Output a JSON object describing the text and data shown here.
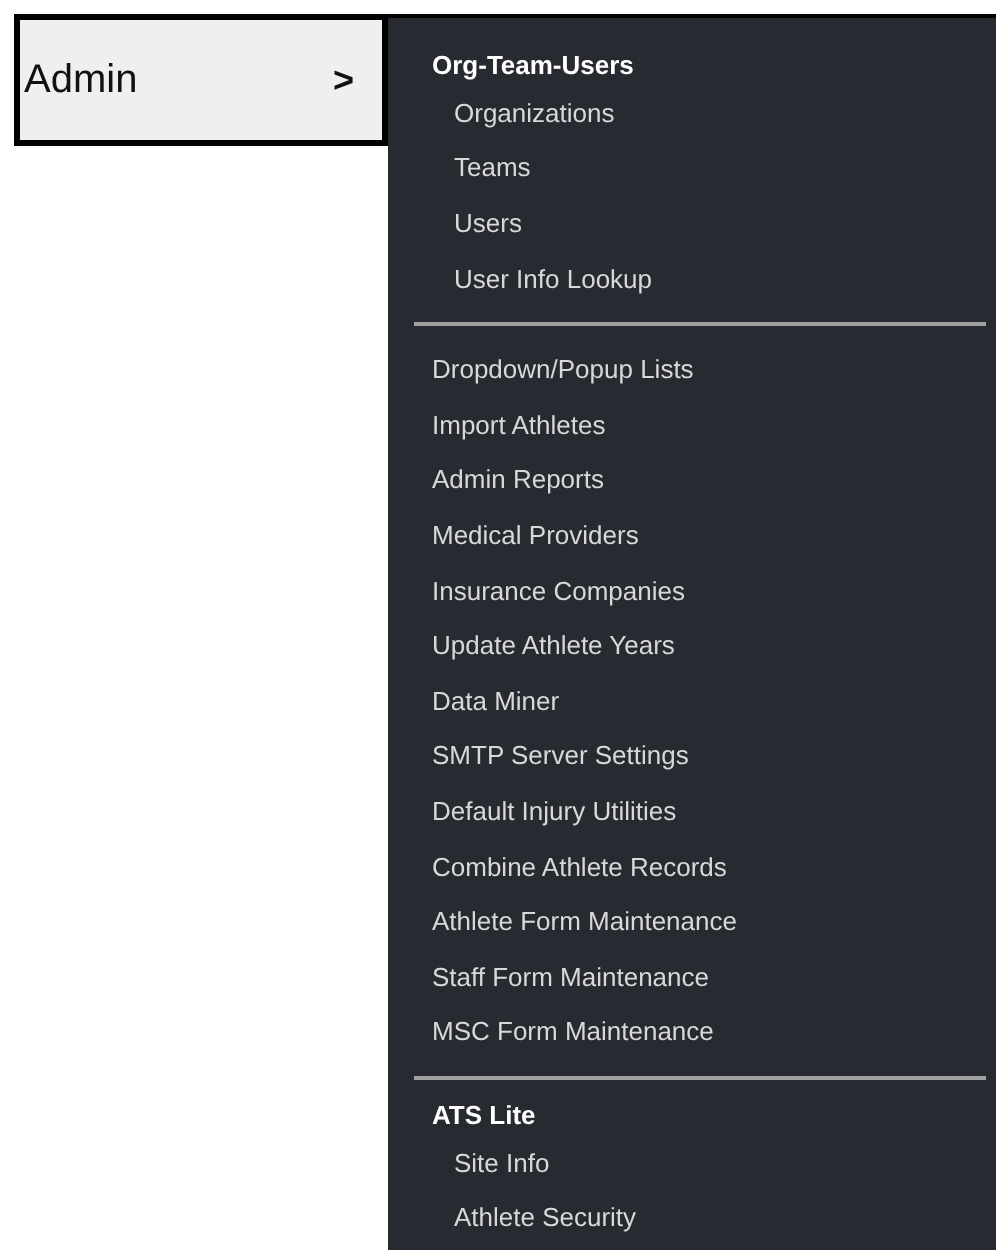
{
  "trigger": {
    "label": "Admin",
    "caret": ">"
  },
  "menu": {
    "sections": [
      {
        "heading": "Org-Team-Users",
        "items": [
          "Organizations",
          "Teams",
          "Users",
          "User Info Lookup"
        ]
      },
      {
        "items": [
          "Dropdown/Popup Lists",
          "Import Athletes",
          "Admin Reports",
          "Medical Providers",
          "Insurance Companies",
          "Update Athlete Years",
          "Data Miner",
          "SMTP Server Settings",
          "Default Injury Utilities",
          "Combine Athlete Records",
          "Athlete Form Maintenance",
          "Staff Form Maintenance",
          "MSC Form Maintenance"
        ]
      },
      {
        "heading": "ATS Lite",
        "items": [
          "Site Info",
          "Athlete Security"
        ]
      }
    ]
  }
}
